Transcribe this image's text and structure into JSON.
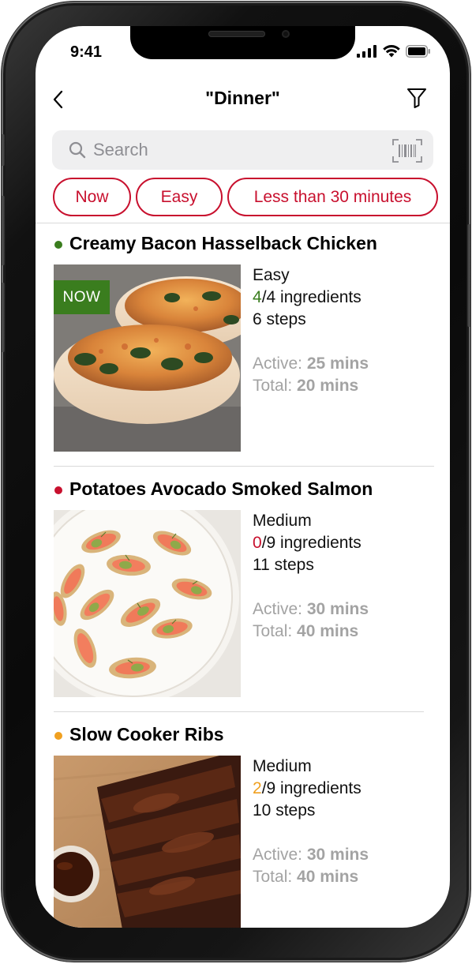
{
  "status_bar": {
    "time": "9:41"
  },
  "nav": {
    "title": "\"Dinner\""
  },
  "search": {
    "placeholder": "Search"
  },
  "filters": [
    {
      "label": "Now"
    },
    {
      "label": "Easy"
    },
    {
      "label": "Less than 30 minutes"
    }
  ],
  "recipes": [
    {
      "title": "Creamy Bacon Hasselback Chicken",
      "status_color": "#3a7d1e",
      "badge": "NOW",
      "difficulty": "Easy",
      "ingredients_have": "4",
      "ingredients_rest": "/4 ingredients",
      "ingredients_color": "#3a7d1e",
      "steps": "6 steps",
      "active_label": "Active: ",
      "active_value": "25 mins",
      "total_label": "Total: ",
      "total_value": "20 mins"
    },
    {
      "title": "Potatoes Avocado Smoked Salmon",
      "status_color": "#c8102e",
      "difficulty": "Medium",
      "ingredients_have": "0",
      "ingredients_rest": "/9 ingredients",
      "ingredients_color": "#c8102e",
      "steps": "11 steps",
      "active_label": "Active: ",
      "active_value": "30 mins",
      "total_label": "Total: ",
      "total_value": "40 mins"
    },
    {
      "title": "Slow Cooker Ribs",
      "status_color": "#f0a020",
      "difficulty": "Medium",
      "ingredients_have": "2",
      "ingredients_rest": "/9 ingredients",
      "ingredients_color": "#f0a020",
      "steps": "10 steps",
      "active_label": "Active: ",
      "active_value": "30 mins",
      "total_label": "Total: ",
      "total_value": "40 mins"
    }
  ],
  "colors": {
    "accent": "#c8102e",
    "available": "#3a7d1e",
    "partial": "#f0a020",
    "muted_text": "#a3a3a3"
  }
}
